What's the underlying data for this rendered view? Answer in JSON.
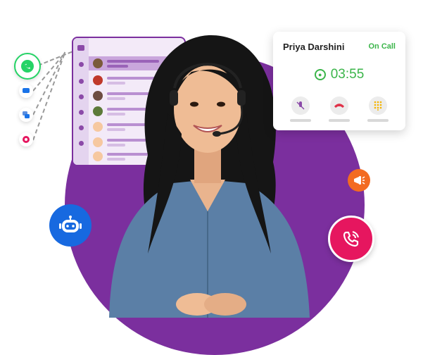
{
  "call_card": {
    "caller_name": "Priya Darshini",
    "status": "On Call",
    "timer": "03:55",
    "buttons": [
      "mute",
      "end-call",
      "keypad"
    ]
  },
  "channels": [
    "whatsapp-icon",
    "chat-icon",
    "messenger-icon",
    "voice-icon"
  ],
  "badges": [
    "bot-icon",
    "megaphone-icon",
    "phone-ringing-icon"
  ],
  "colors": {
    "brand_purple": "#7b2f9e",
    "whatsapp_green": "#25d366",
    "call_green": "#3bb54a",
    "end_red": "#e0334a",
    "bot_blue": "#1769e0",
    "mega_orange": "#f36b21",
    "phone_pink": "#e6165f"
  }
}
